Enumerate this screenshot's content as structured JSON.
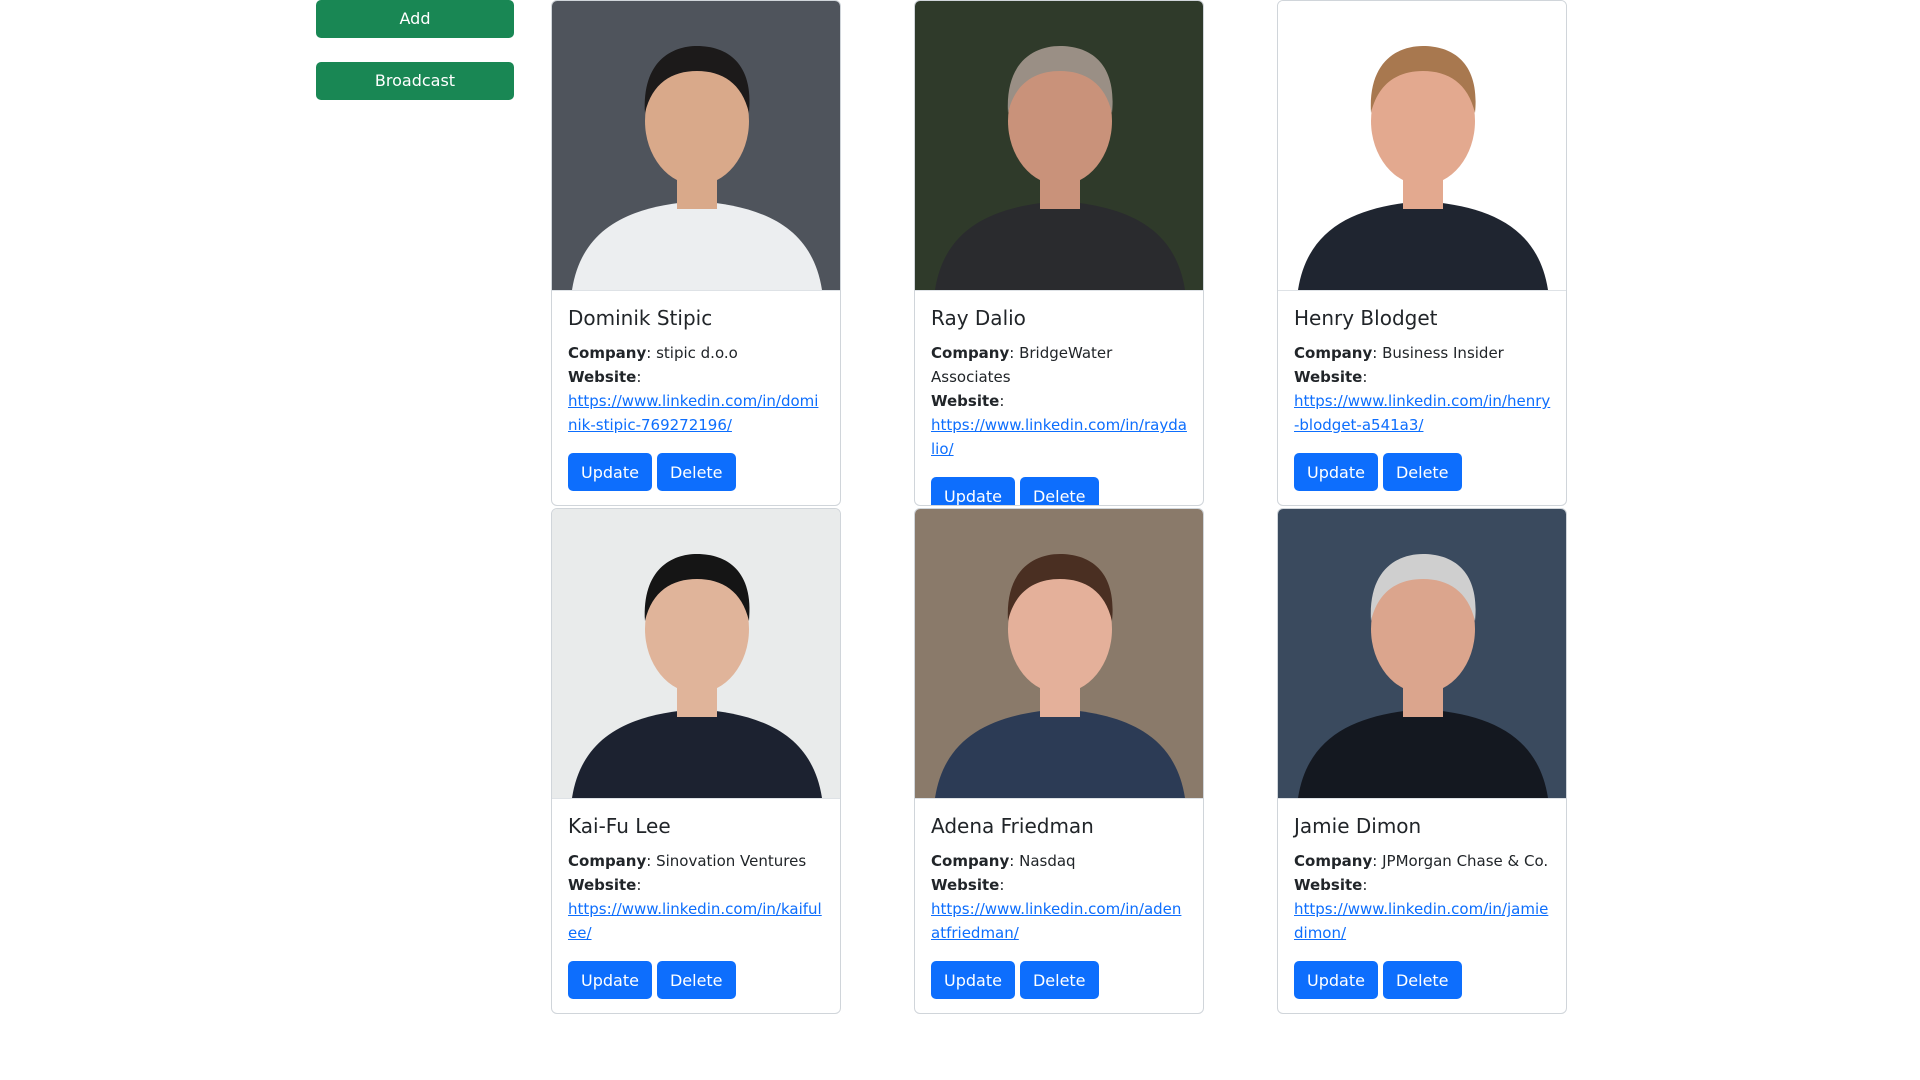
{
  "sidebar": {
    "add_label": "Add",
    "broadcast_label": "Broadcast"
  },
  "field_labels": {
    "company": "Company",
    "website": "Website"
  },
  "buttons": {
    "update": "Update",
    "delete": "Delete"
  },
  "contacts": [
    {
      "name": "Dominik Stipic",
      "company": "stipic d.o.o",
      "website": "https://www.linkedin.com/in/dominik-stipic-769272196/",
      "photo_bg": "#4f545c",
      "photo_skin": "#d9a98a",
      "photo_hair": "#1c1a1a",
      "photo_clothes": "#eceef0"
    },
    {
      "name": "Ray Dalio",
      "company": "BridgeWater Associates",
      "website": "https://www.linkedin.com/in/raydalio/",
      "photo_bg": "#2f3a2a",
      "photo_skin": "#c9927a",
      "photo_hair": "#9a8f85",
      "photo_clothes": "#2a2b2e"
    },
    {
      "name": "Henry Blodget",
      "company": "Business Insider",
      "website": "https://www.linkedin.com/in/henry-blodget-a541a3/",
      "photo_bg": "#ffffff",
      "photo_skin": "#e3a98f",
      "photo_hair": "#a8784f",
      "photo_clothes": "#1f2530"
    },
    {
      "name": "Kai-Fu Lee",
      "company": "Sinovation Ventures",
      "website": "https://www.linkedin.com/in/kaifulee/",
      "photo_bg": "#e9ebeb",
      "photo_skin": "#e0b49a",
      "photo_hair": "#151515",
      "photo_clothes": "#1c2230"
    },
    {
      "name": "Adena Friedman",
      "company": "Nasdaq",
      "website": "https://www.linkedin.com/in/adenatfriedman/",
      "photo_bg": "#8a7a6a",
      "photo_skin": "#e4b09a",
      "photo_hair": "#4a2f22",
      "photo_clothes": "#2c3b55"
    },
    {
      "name": "Jamie Dimon",
      "company": "JPMorgan Chase & Co.",
      "website": "https://www.linkedin.com/in/jamiedimon/",
      "photo_bg": "#3a4a5e",
      "photo_skin": "#dba58d",
      "photo_hair": "#cfcfcf",
      "photo_clothes": "#141820"
    }
  ]
}
